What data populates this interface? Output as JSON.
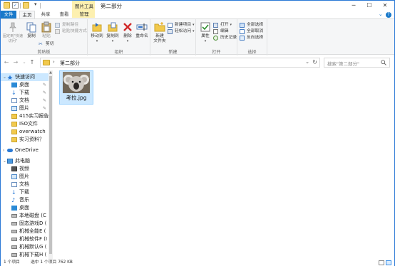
{
  "title": {
    "contextual_tab": "图片工具",
    "folder_name": "第二部分"
  },
  "tabs": {
    "file": "文件",
    "home": "主页",
    "share": "共享",
    "view": "查看",
    "manage": "管理",
    "help_icon": "question-icon"
  },
  "ribbon": {
    "clipboard": {
      "pin_quick_access": "固定到\"快速访问\"",
      "copy": "复制",
      "paste": "粘贴",
      "copy_path": "复制路径",
      "paste_shortcut": "粘贴快捷方式",
      "cut": "剪切",
      "label": "剪贴板"
    },
    "organize": {
      "move_to": "移动到",
      "copy_to": "复制到",
      "delete": "删除",
      "rename": "重命名",
      "label": "组织"
    },
    "new": {
      "new_folder": "新建\n文件夹",
      "new_item": "新建项目",
      "easy_access": "轻松访问",
      "label": "新建"
    },
    "open": {
      "properties": "属性",
      "open": "打开",
      "edit": "编辑",
      "history": "历史记录",
      "label": "打开"
    },
    "select": {
      "select_all": "全部选择",
      "select_none": "全部取消",
      "invert": "反向选择",
      "label": "选择"
    }
  },
  "address": {
    "path": "第二部分",
    "search_placeholder": "搜索\"第二部分\""
  },
  "nav": {
    "quick_access": "快速访问",
    "desktop": "桌面",
    "downloads": "下载",
    "documents": "文档",
    "pictures": "图片",
    "folder1": "415实习报告",
    "folder2": "ISO文件",
    "folder3": "overwatch",
    "folder4": "实习资料？",
    "onedrive": "OneDrive",
    "this_pc": "此电脑",
    "videos": "视频",
    "pc_pictures": "图片",
    "pc_documents": "文档",
    "pc_downloads": "下载",
    "music": "音乐",
    "pc_desktop": "桌面",
    "drive_c": "本地磁盘 (C",
    "drive_d": "固态游戏D (",
    "drive_e": "机械全能E (",
    "drive_f": "机械软件F (I",
    "drive_g": "机械默认G (",
    "drive_h": "机械下载H ("
  },
  "content": {
    "files": [
      {
        "name": "考拉.jpg"
      }
    ]
  },
  "status": {
    "item_count": "1 个项目",
    "selection": "选中 1 个项目  762 KB"
  },
  "colors": {
    "accent": "#1979ca",
    "selection": "#cce8ff",
    "contextual": "#fdf0b0"
  }
}
